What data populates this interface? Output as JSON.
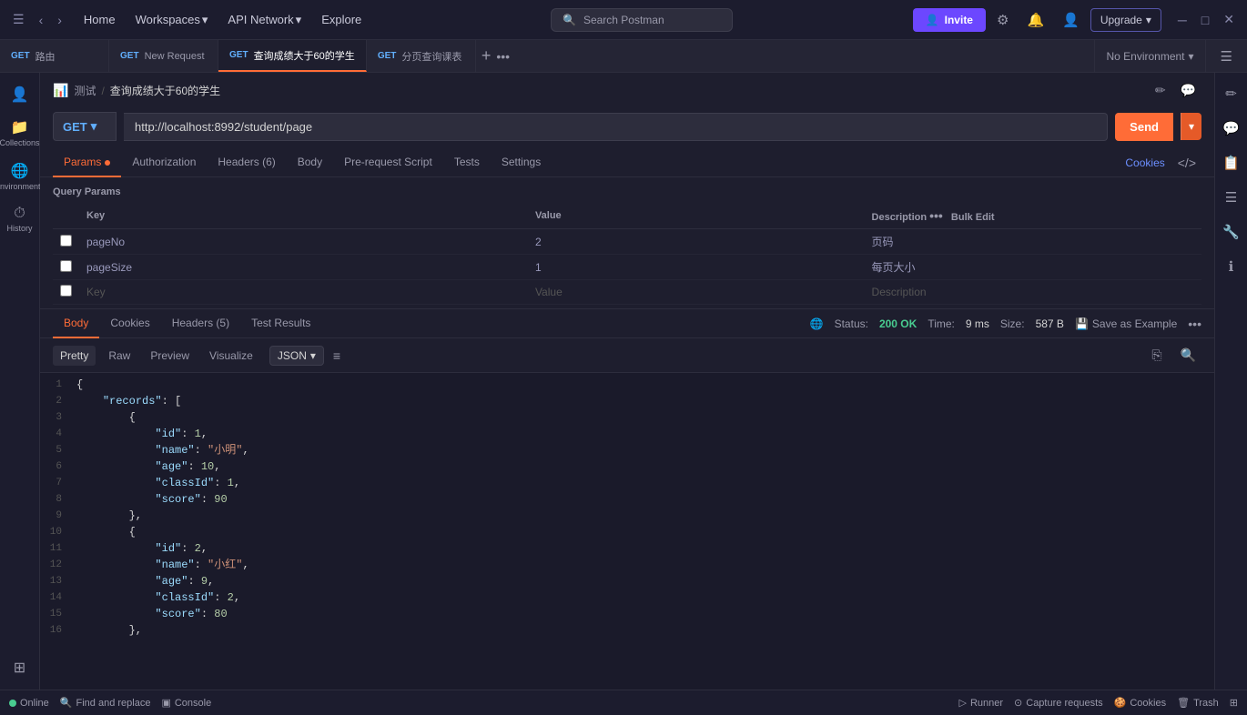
{
  "topnav": {
    "home_label": "Home",
    "workspaces_label": "Workspaces",
    "api_network_label": "API Network",
    "explore_label": "Explore",
    "search_placeholder": "Search Postman",
    "invite_label": "Invite",
    "upgrade_label": "Upgrade"
  },
  "tabs": [
    {
      "method": "GET",
      "label": "路由",
      "active": false
    },
    {
      "method": "GET",
      "label": "New Request",
      "active": false
    },
    {
      "method": "GET",
      "label": "查询成绩大于60的学生",
      "active": true
    },
    {
      "method": "GET",
      "label": "分页查询课表",
      "active": false
    }
  ],
  "env_selector": {
    "label": "No Environment"
  },
  "breadcrumb": {
    "icon": "📊",
    "workspace": "测试",
    "separator": "/",
    "current": "查询成绩大于60的学生"
  },
  "request": {
    "method": "GET",
    "url": "http://localhost:8992/student/page",
    "send_label": "Send"
  },
  "param_tabs": [
    {
      "label": "Params",
      "active": true,
      "has_dot": true
    },
    {
      "label": "Authorization",
      "active": false
    },
    {
      "label": "Headers (6)",
      "active": false
    },
    {
      "label": "Body",
      "active": false
    },
    {
      "label": "Pre-request Script",
      "active": false
    },
    {
      "label": "Tests",
      "active": false
    },
    {
      "label": "Settings",
      "active": false
    }
  ],
  "cookies_link": "Cookies",
  "query_params": {
    "section_label": "Query Params",
    "columns": [
      "Key",
      "Value",
      "Description"
    ],
    "bulk_edit": "Bulk Edit",
    "rows": [
      {
        "key": "pageNo",
        "value": "2",
        "description": "页码",
        "checked": false
      },
      {
        "key": "pageSize",
        "value": "1",
        "description": "每页大小",
        "checked": false
      }
    ],
    "empty_row": {
      "key": "Key",
      "value": "Value",
      "description": "Description"
    }
  },
  "response": {
    "tabs": [
      {
        "label": "Body",
        "active": true
      },
      {
        "label": "Cookies",
        "active": false
      },
      {
        "label": "Headers (5)",
        "active": false
      },
      {
        "label": "Test Results",
        "active": false
      }
    ],
    "status": "200 OK",
    "time": "9 ms",
    "size": "587 B",
    "save_example": "Save as Example",
    "format_tabs": [
      {
        "label": "Pretty",
        "active": true
      },
      {
        "label": "Raw",
        "active": false
      },
      {
        "label": "Preview",
        "active": false
      },
      {
        "label": "Visualize",
        "active": false
      }
    ],
    "json_format": "JSON",
    "code_lines": [
      {
        "num": 1,
        "content": "{",
        "type": "brace"
      },
      {
        "num": 2,
        "content": "    \"records\": [",
        "type": "mixed"
      },
      {
        "num": 3,
        "content": "        {",
        "type": "brace"
      },
      {
        "num": 4,
        "content": "            \"id\": 1,",
        "type": "mixed"
      },
      {
        "num": 5,
        "content": "            \"name\": \"小明\",",
        "type": "mixed"
      },
      {
        "num": 6,
        "content": "            \"age\": 10,",
        "type": "mixed"
      },
      {
        "num": 7,
        "content": "            \"classId\": 1,",
        "type": "mixed"
      },
      {
        "num": 8,
        "content": "            \"score\": 90",
        "type": "mixed"
      },
      {
        "num": 9,
        "content": "        },",
        "type": "brace"
      },
      {
        "num": 10,
        "content": "        {",
        "type": "brace"
      },
      {
        "num": 11,
        "content": "            \"id\": 2,",
        "type": "mixed"
      },
      {
        "num": 12,
        "content": "            \"name\": \"小红\",",
        "type": "mixed"
      },
      {
        "num": 13,
        "content": "            \"age\": 9,",
        "type": "mixed"
      },
      {
        "num": 14,
        "content": "            \"classId\": 2,",
        "type": "mixed"
      },
      {
        "num": 15,
        "content": "            \"score\": 80",
        "type": "mixed"
      },
      {
        "num": 16,
        "content": "        },",
        "type": "brace"
      }
    ]
  },
  "sidebar": {
    "items": [
      {
        "icon": "👤",
        "label": ""
      },
      {
        "icon": "📁",
        "label": "Collections"
      },
      {
        "icon": "🌐",
        "label": "Environments"
      },
      {
        "icon": "⏱️",
        "label": "History"
      },
      {
        "icon": "⊞",
        "label": ""
      }
    ]
  },
  "statusbar": {
    "online_label": "Online",
    "find_replace_label": "Find and replace",
    "console_label": "Console",
    "runner_label": "Runner",
    "capture_label": "Capture requests",
    "cookies_label": "Cookies",
    "trash_label": "Trash"
  }
}
